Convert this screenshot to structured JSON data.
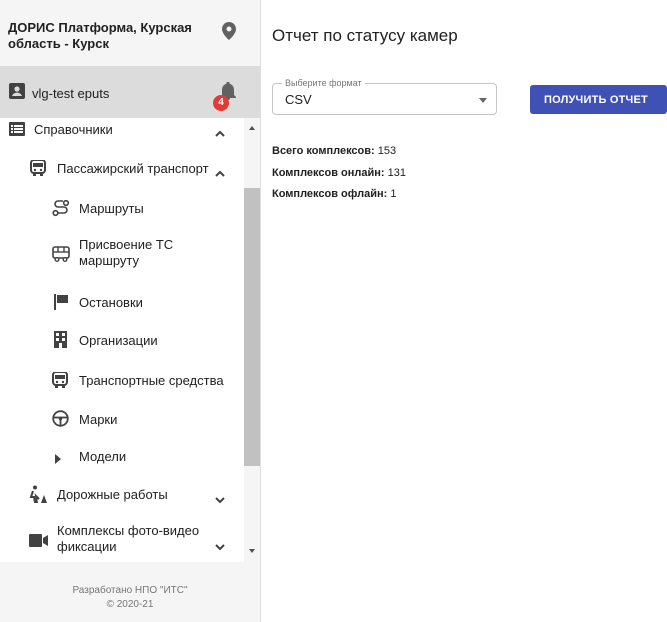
{
  "sidebar": {
    "header_title": "ДОРИС Платформа, Курская область - Курск",
    "user_name": "vlg-test eputs",
    "notification_count": "4",
    "menu": [
      {
        "label": "Справочники",
        "expanded": true
      },
      {
        "label": "Пассажирский транспорт",
        "expanded": true
      },
      {
        "label": "Маршруты"
      },
      {
        "label": "Присвоение ТС маршруту"
      },
      {
        "label": "Остановки"
      },
      {
        "label": "Организации"
      },
      {
        "label": "Транспортные средства"
      },
      {
        "label": "Марки"
      },
      {
        "label": "Модели"
      },
      {
        "label": "Дорожные работы",
        "expanded": false
      },
      {
        "label": "Комплексы фото-видео фиксации",
        "expanded": false
      }
    ],
    "footer_line1": "Разработано НПО \"ИТС\"",
    "footer_line2": "© 2020-21"
  },
  "main": {
    "title": "Отчет по статусу камер",
    "format_label": "Выберите формат",
    "format_value": "CSV",
    "get_report_label": "ПОЛУЧИТЬ ОТЧЕТ",
    "stats": [
      {
        "label": "Всего комплексов:",
        "value": "153"
      },
      {
        "label": "Комплексов онлайн:",
        "value": "131"
      },
      {
        "label": "Комплексов офлайн:",
        "value": "1"
      }
    ]
  },
  "colors": {
    "accent": "#3f51b5",
    "badge": "#e53935"
  }
}
